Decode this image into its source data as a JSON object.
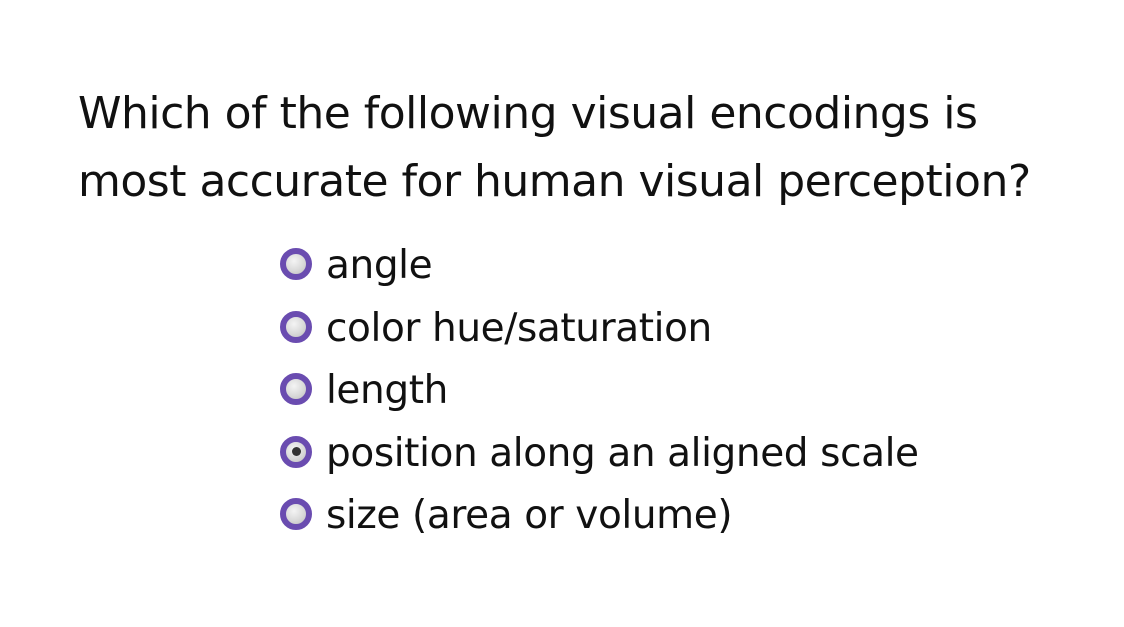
{
  "question": {
    "line1": "Which of the following visual encodings is",
    "line2": "most accurate for human visual perception?"
  },
  "options": [
    {
      "label": "angle",
      "selected": false
    },
    {
      "label": "color hue/saturation",
      "selected": false
    },
    {
      "label": "length",
      "selected": false
    },
    {
      "label": "position along an aligned scale",
      "selected": true
    },
    {
      "label": "size (area or volume)",
      "selected": false
    }
  ],
  "colors": {
    "radio_ring": "#6a4cb0",
    "radio_fill": "#d9d9d9",
    "radio_dot": "#333333",
    "text": "#111111",
    "background": "#ffffff"
  },
  "icons": {
    "radio": "radio-button-icon"
  }
}
